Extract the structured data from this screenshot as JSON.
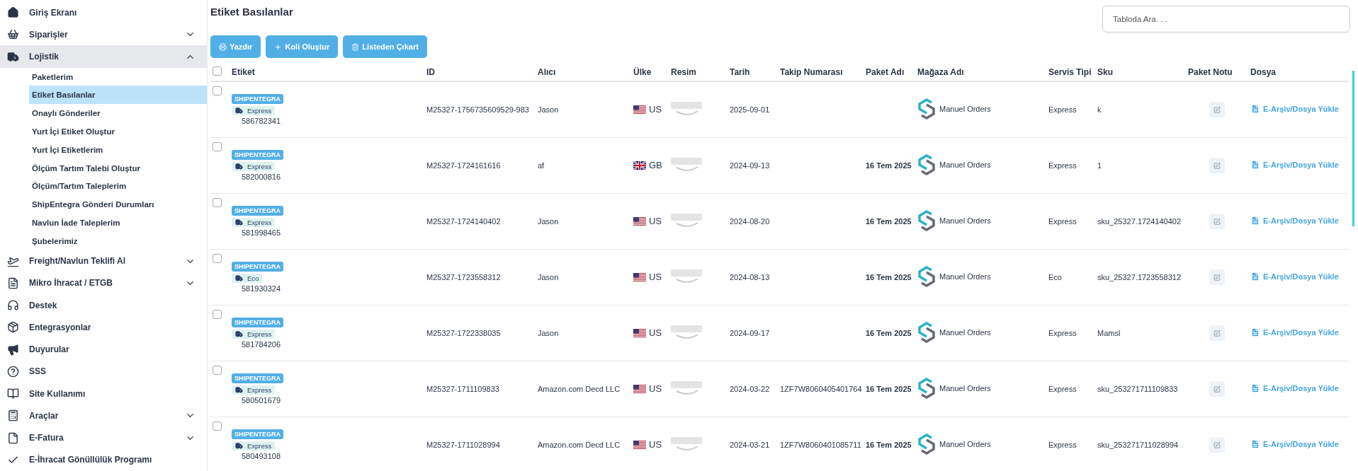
{
  "sidebar": {
    "items": [
      {
        "label": "Giriş Ekranı"
      },
      {
        "label": "Siparişler",
        "expanded": false
      },
      {
        "label": "Lojistik",
        "expanded": true,
        "children": [
          {
            "label": "Paketlerim",
            "selected": false
          },
          {
            "label": "Etiket Basılanlar",
            "selected": true
          },
          {
            "label": "Onaylı Gönderiler",
            "selected": false
          },
          {
            "label": "Yurt İçi Etiket Oluştur",
            "selected": false
          },
          {
            "label": "Yurt İçi Etiketlerim",
            "selected": false
          },
          {
            "label": "Ölçüm Tartım Talebi Oluştur",
            "selected": false
          },
          {
            "label": "Ölçüm/Tartım Taleplerim",
            "selected": false
          },
          {
            "label": "ShipEntegra Gönderi Durumları",
            "selected": false
          },
          {
            "label": "Navlun İade Taleplerim",
            "selected": false
          },
          {
            "label": "Şubelerimiz",
            "selected": false
          }
        ]
      },
      {
        "label": "Freight/Navlun Teklifi Al",
        "expanded": false
      },
      {
        "label": "Mikro İhracat / ETGB",
        "expanded": false
      },
      {
        "label": "Destek"
      },
      {
        "label": "Entegrasyonlar"
      },
      {
        "label": "Duyurular"
      },
      {
        "label": "SSS"
      },
      {
        "label": "Site Kullanımı"
      },
      {
        "label": "Araçlar",
        "expanded": false
      },
      {
        "label": "E-Fatura",
        "expanded": false
      },
      {
        "label": "E-İhracat Gönüllülük Programı"
      }
    ]
  },
  "page": {
    "title": "Etiket Basılanlar",
    "search": {
      "placeholder": "Tabloda Ara. . ."
    },
    "buttons": [
      "Yazdır",
      "Koli Oluştur",
      "Listeden Çıkart"
    ]
  },
  "table": {
    "select_all": {
      "checked": false
    },
    "columns": [
      "Etiket",
      "ID",
      "Alıcı",
      "Ülke",
      "Resim",
      "Tarih",
      "Takip Numarası",
      "Paket Adı",
      "Mağaza Adı",
      "Servis Tipi",
      "Sku",
      "Paket Notu",
      "Dosya"
    ],
    "rows": [
      {
        "checked": false,
        "carrier": "SHIPENTEGRA",
        "service_tag": "Express",
        "label_no": "586782341",
        "id": "M25327-1756735609529-983",
        "recipient": "Jason",
        "country": "US",
        "flag": {
          "kind": "us"
        },
        "date": "2025-09-01",
        "store": "Manuel Orders",
        "service": "Express",
        "sku": "k",
        "file": "E-Arşiv/Dosya Yükle"
      },
      {
        "checked": false,
        "carrier": "SHIPENTEGRA",
        "service_tag": "Express",
        "label_no": "582000816",
        "id": "M25327-1724161616",
        "recipient": "af",
        "country": "GB",
        "flag": {
          "kind": "gb"
        },
        "date": "2024-09-13",
        "package": "16 Tem 2025",
        "store": "Manuel Orders",
        "service": "Express",
        "sku": "1",
        "file": "E-Arşiv/Dosya Yükle"
      },
      {
        "checked": false,
        "carrier": "SHIPENTEGRA",
        "service_tag": "Express",
        "label_no": "581998465",
        "id": "M25327-1724140402",
        "recipient": "Jason",
        "country": "US",
        "flag": {
          "kind": "us"
        },
        "date": "2024-08-20",
        "package": "16 Tem 2025",
        "store": "Manuel Orders",
        "service": "Express",
        "sku": "sku_25327.1724140402",
        "file": "E-Arşiv/Dosya Yükle"
      },
      {
        "checked": false,
        "carrier": "SHIPENTEGRA",
        "service_tag": "Eco",
        "label_no": "581930324",
        "id": "M25327-1723558312",
        "recipient": "Jason",
        "country": "US",
        "flag": {
          "kind": "us"
        },
        "date": "2024-08-13",
        "package": "16 Tem 2025",
        "store": "Manuel Orders",
        "service": "Eco",
        "sku": "sku_25327.1723558312",
        "file": "E-Arşiv/Dosya Yükle"
      },
      {
        "checked": false,
        "carrier": "SHIPENTEGRA",
        "service_tag": "Express",
        "label_no": "581784206",
        "id": "M25327-1722338035",
        "recipient": "Jason",
        "country": "US",
        "flag": {
          "kind": "us"
        },
        "date": "2024-09-17",
        "package": "16 Tem 2025",
        "store": "Manuel Orders",
        "service": "Express",
        "sku": "Mamsl",
        "file": "E-Arşiv/Dosya Yükle"
      },
      {
        "checked": false,
        "carrier": "SHIPENTEGRA",
        "service_tag": "Express",
        "label_no": "580501679",
        "id": "M25327-1711109833",
        "recipient": "Amazon.com Decd LLC",
        "country": "US",
        "flag": {
          "kind": "us"
        },
        "date": "2024-03-22",
        "tracking": "1ZF7W8060405401764",
        "package": "16 Tem 2025",
        "store": "Manuel Orders",
        "service": "Express",
        "sku": "sku_253271711109833",
        "file": "E-Arşiv/Dosya Yükle"
      },
      {
        "checked": false,
        "carrier": "SHIPENTEGRA",
        "service_tag": "Express",
        "label_no": "580493108",
        "id": "M25327-1711028994",
        "recipient": "Amazon.com Decd LLC",
        "country": "US",
        "flag": {
          "kind": "us"
        },
        "date": "2024-03-21",
        "tracking": "1ZF7W8060401085711",
        "package": "16 Tem 2025",
        "store": "Manuel Orders",
        "service": "Express",
        "sku": "sku_253271711028994",
        "file": "E-Arşiv/Dosya Yükle"
      }
    ]
  }
}
